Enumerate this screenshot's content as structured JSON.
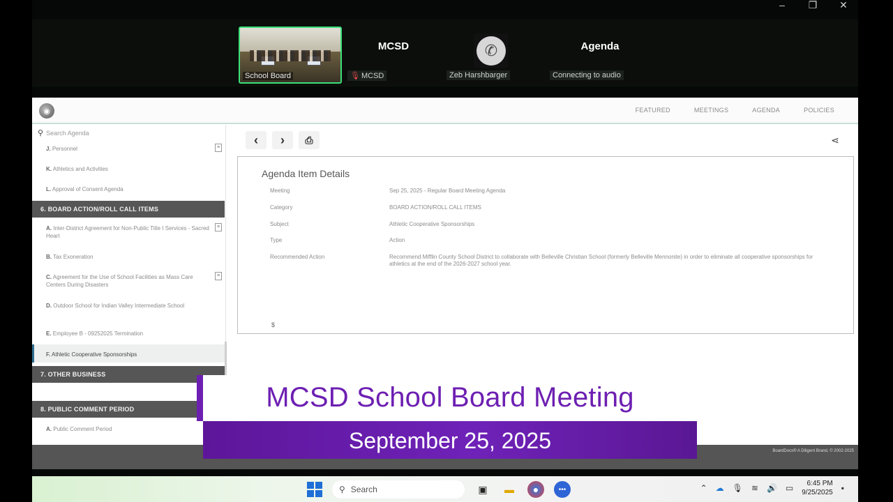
{
  "window_controls": [
    "–",
    "❐",
    "✕"
  ],
  "participants": {
    "video_tile_label": "School Board",
    "mcsd_name": "MCSD",
    "mcsd_sub": "MCSD",
    "phone_sub": "Zeb Harshbarger",
    "agenda_name": "Agenda",
    "agenda_sub": "Connecting to audio"
  },
  "app": {
    "nav": [
      "FEATURED",
      "MEETINGS",
      "AGENDA",
      "POLICIES"
    ],
    "search_placeholder": "Search Agenda",
    "sidebar": {
      "items_top": [
        {
          "letter": "J.",
          "label": "Personnel"
        },
        {
          "letter": "K.",
          "label": "Athletics and Activities"
        },
        {
          "letter": "L.",
          "label": "Approval of Consent Agenda"
        }
      ],
      "section_6": "6. BOARD ACTION/ROLL CALL ITEMS",
      "items_6": [
        {
          "letter": "A.",
          "label": "Inter-District Agreement for Non-Public Title I Services - Sacred Heart"
        },
        {
          "letter": "B.",
          "label": "Tax Exoneration"
        },
        {
          "letter": "C.",
          "label": "Agreement for the Use of School Facilities as Mass Care Centers During Disasters"
        },
        {
          "letter": "D.",
          "label": "Outdoor School for Indian Valley Intermediate School"
        },
        {
          "letter": "E.",
          "label": "Employee B - 09252025 Termination"
        },
        {
          "letter": "F.",
          "label": "Athletic Cooperative Sponsorships"
        }
      ],
      "section_7": "7. OTHER BUSINESS",
      "section_8": "8. PUBLIC COMMENT PERIOD",
      "items_8": [
        {
          "letter": "A.",
          "label": "Public Comment Period"
        }
      ]
    },
    "details": {
      "heading": "Agenda Item Details",
      "rows": [
        {
          "key": "Meeting",
          "value": "Sep 25, 2025 - Regular Board Meeting Agenda"
        },
        {
          "key": "Category",
          "value": "BOARD ACTION/ROLL CALL ITEMS"
        },
        {
          "key": "Subject",
          "value": "Athletic Cooperative Sponsorships"
        },
        {
          "key": "Type",
          "value": "Action"
        },
        {
          "key": "Recommended Action",
          "value": "Recommend Mifflin County School District to collaborate with Belleville Christian School (formerly Belleville Mennonite) in order to eliminate all cooperative sponsorships for athletics at the end of the 2026-2027 school year."
        }
      ],
      "currency": "$"
    },
    "footer_copyright": "BoardDocs® A Diligent Brand, © 2002-2025"
  },
  "overlay": {
    "title": "MCSD School Board Meeting",
    "date": "September 25, 2025"
  },
  "taskbar": {
    "search_label": "Search",
    "time": "6:45 PM",
    "date": "9/25/2025"
  }
}
